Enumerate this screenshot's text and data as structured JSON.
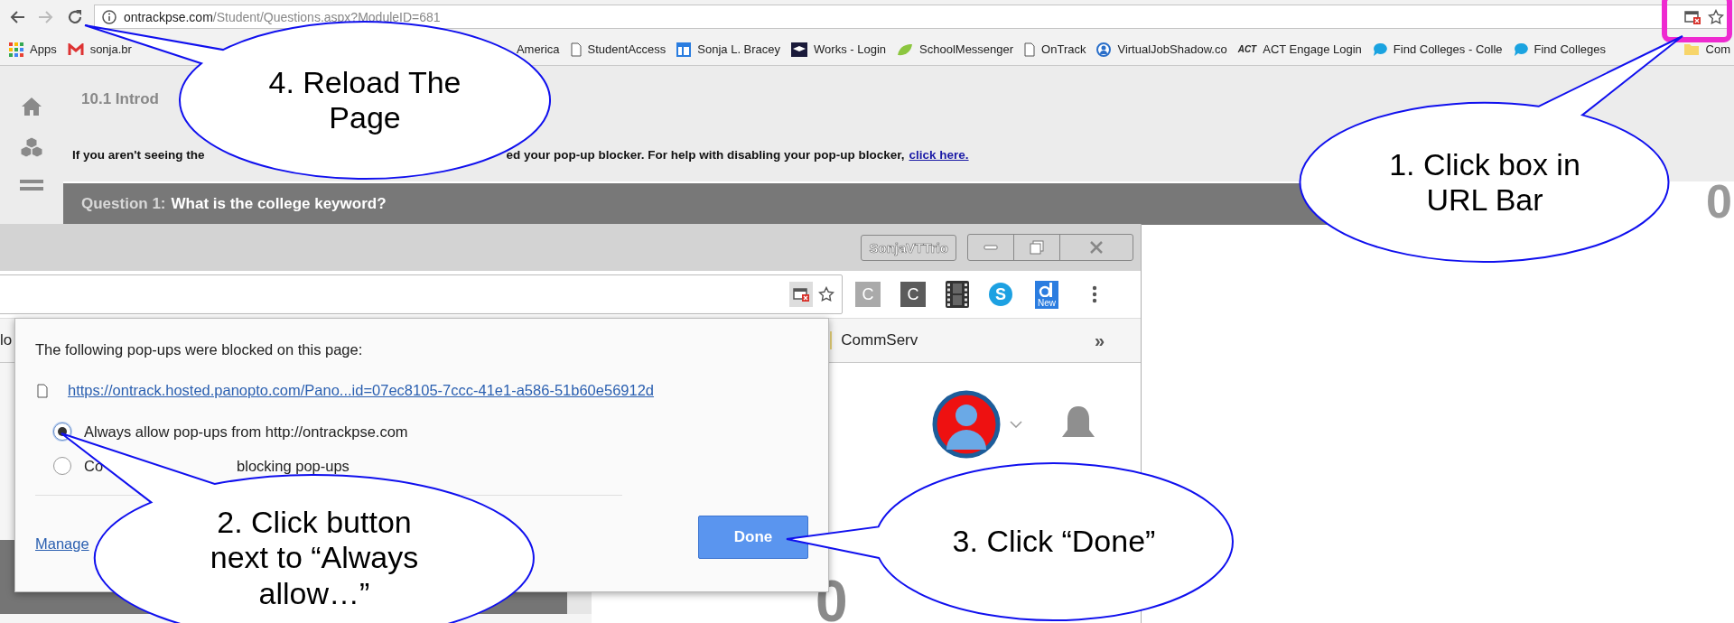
{
  "browser": {
    "url_host": "ontrackpse.com",
    "url_path": "/Student/Questions.aspx?ModuleID=681",
    "bookmarks": [
      {
        "label": "Apps"
      },
      {
        "label": "sonja.br"
      },
      {
        "label": "America"
      },
      {
        "label": "StudentAccess"
      },
      {
        "label": "Sonja L. Bracey"
      },
      {
        "label": "Works - Login"
      },
      {
        "label": "SchoolMessenger"
      },
      {
        "label": "OnTrack"
      },
      {
        "label": "VirtualJobShadow.co"
      },
      {
        "label": "ACT Engage Login",
        "logo": "ACT"
      },
      {
        "label": "Find Colleges - Colle"
      },
      {
        "label": "Find Colleges"
      },
      {
        "label": "Com"
      }
    ]
  },
  "page": {
    "heading": "10.1 Introd",
    "notice_start": "If you aren't seeing the",
    "notice_end": "ed your pop-up blocker. For help with disabling your pop-up blocker,",
    "notice_link": "click here.",
    "question_label": "Question 1:",
    "question_text": "What is the college keyword?",
    "score": "0"
  },
  "second_window": {
    "profile": "SonjaVTTrio",
    "extensions": [
      {
        "kind": "letter",
        "text": "C",
        "color": "#aaaaaa"
      },
      {
        "kind": "letter",
        "text": "C",
        "color": "#5b5b5b"
      },
      {
        "kind": "film"
      },
      {
        "kind": "round",
        "text": "S",
        "color": "#1da1e2"
      },
      {
        "kind": "badge",
        "text": "New",
        "color": "#2b7de0"
      }
    ],
    "bookmarks": [
      "lo",
      "CommServ"
    ],
    "more": "»",
    "score": "0",
    "dialog": {
      "title": "The following pop-ups were blocked on this page:",
      "link": "https://ontrack.hosted.panopto.com/Pano...id=07ec8105-7ccc-41e1-a586-51b60e56912d",
      "options": [
        {
          "label": "Always allow pop-ups from http://ontrackpse.com",
          "selected": true
        },
        {
          "label": "Co",
          "label_rest": "blocking pop-ups",
          "selected": false
        }
      ],
      "manage": "Manage",
      "done": "Done"
    }
  },
  "callouts": [
    {
      "text": "1. Click box in URL Bar"
    },
    {
      "text": "2. Click button next to “Always allow…”"
    },
    {
      "text": "3. Click “Done”"
    },
    {
      "text": "4. Reload The Page"
    }
  ]
}
